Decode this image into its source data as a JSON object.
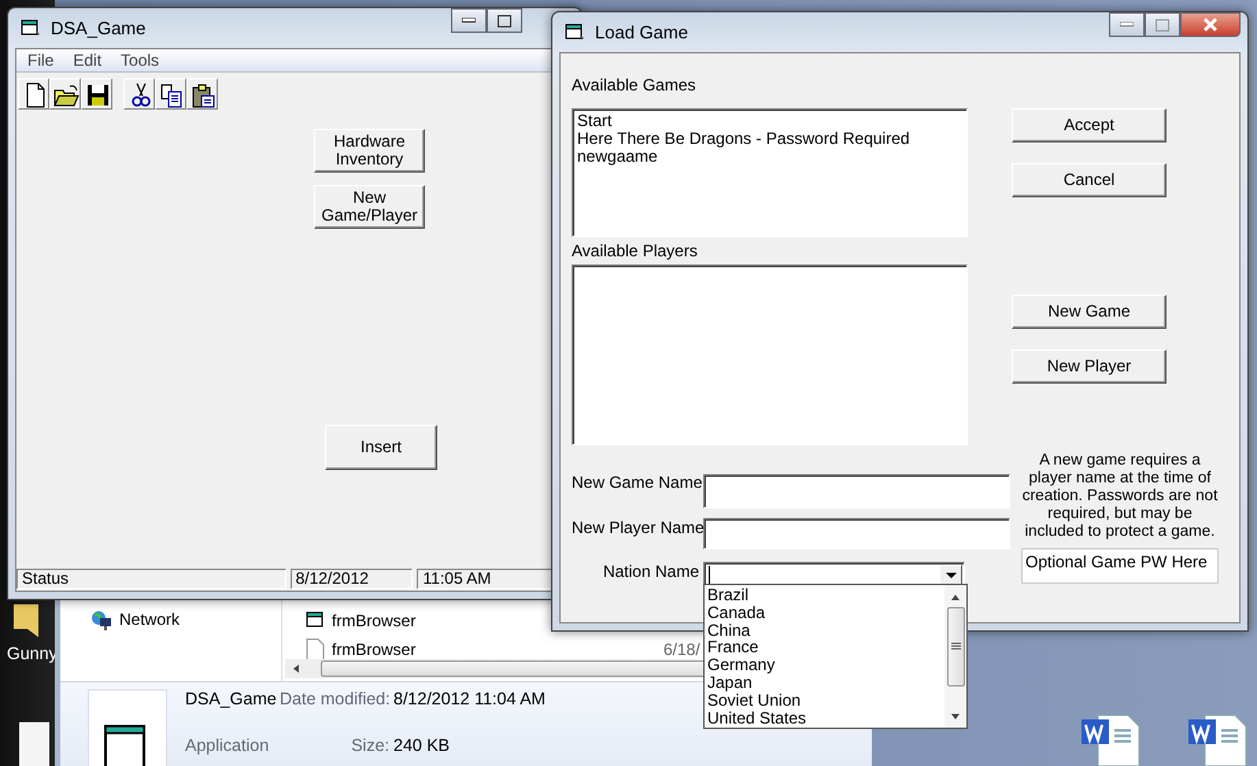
{
  "desktop": {
    "icon_labels": [
      "Gunny"
    ]
  },
  "explorer": {
    "nav_items": [
      "Network"
    ],
    "files": [
      {
        "name": "frmBrowser",
        "kind": "form"
      },
      {
        "name": "frmBrowser",
        "kind": "file"
      }
    ],
    "dates": [
      "6/18/"
    ],
    "details": {
      "name": "DSA_Game",
      "type": "Application",
      "date_label": "Date modified:",
      "date": "8/12/2012 11:04 AM",
      "size_label": "Size:",
      "size": "240 KB"
    }
  },
  "main_window": {
    "title": "DSA_Game",
    "menu": [
      "File",
      "Edit",
      "Tools"
    ],
    "toolbar": [
      {
        "kind": "new"
      },
      {
        "kind": "open"
      },
      {
        "kind": "save"
      },
      {
        "kind": "cut"
      },
      {
        "kind": "copy"
      },
      {
        "kind": "paste"
      }
    ],
    "button_groups": [
      [
        "Hardware Inventory",
        "New\nGame/Player"
      ],
      [
        "Insert"
      ]
    ],
    "status_bar": [
      "Status",
      "8/12/2012",
      "11:05 AM"
    ]
  },
  "dialog": {
    "title": "Load Game",
    "games_label": "Available Games",
    "games": [
      "Start",
      "Here There Be Dragons - Password Required",
      "newgaame"
    ],
    "players_label": "Available Players",
    "top_buttons": [
      "Accept",
      "Cancel"
    ],
    "bottom_buttons": [
      "New Game",
      "New Player"
    ],
    "new_game_label": "New Game Name",
    "new_player_label": "New Player Name",
    "nation": {
      "label": "Nation Name",
      "expanded": true,
      "options": [
        "Brazil",
        "Canada",
        "China",
        "France",
        "Germany",
        "Japan",
        "Soviet Union",
        "United States"
      ]
    },
    "help": "A new game requires a player name at the time of creation. Passwords are not required, but may be included to protect a game.",
    "password": {
      "value": "Optional Game PW Here"
    }
  }
}
